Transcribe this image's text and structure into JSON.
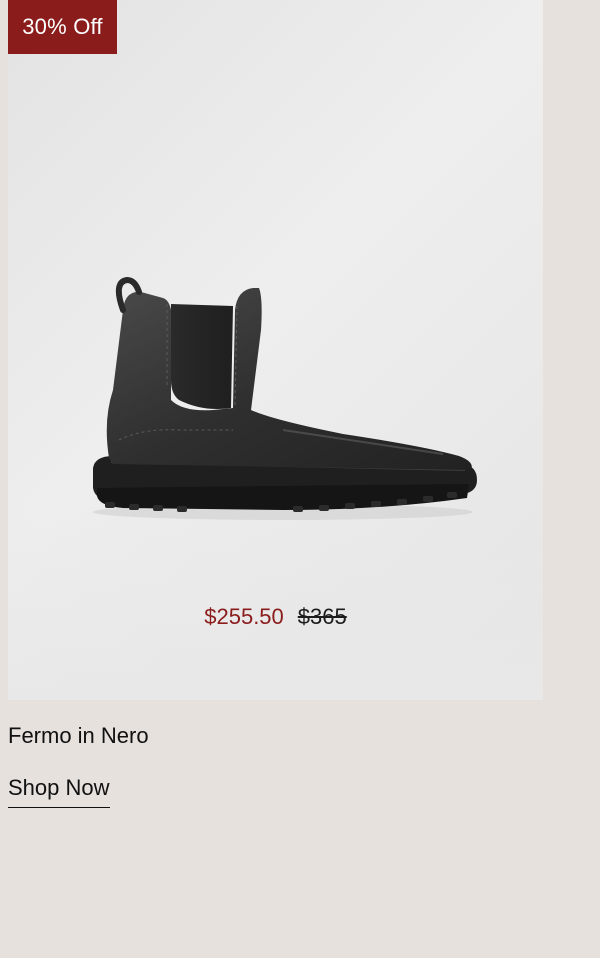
{
  "badge": {
    "label": "30% Off"
  },
  "product": {
    "image_icon": "chelsea-boot-image",
    "sale_price": "$255.50",
    "original_price": "$365",
    "name": "Fermo in Nero",
    "cta_label": "Shop Now"
  },
  "colors": {
    "page_background": "#e6e1dd",
    "badge_background": "#8b1c1c",
    "sale_price": "#8b1c1c",
    "text": "#111111"
  }
}
